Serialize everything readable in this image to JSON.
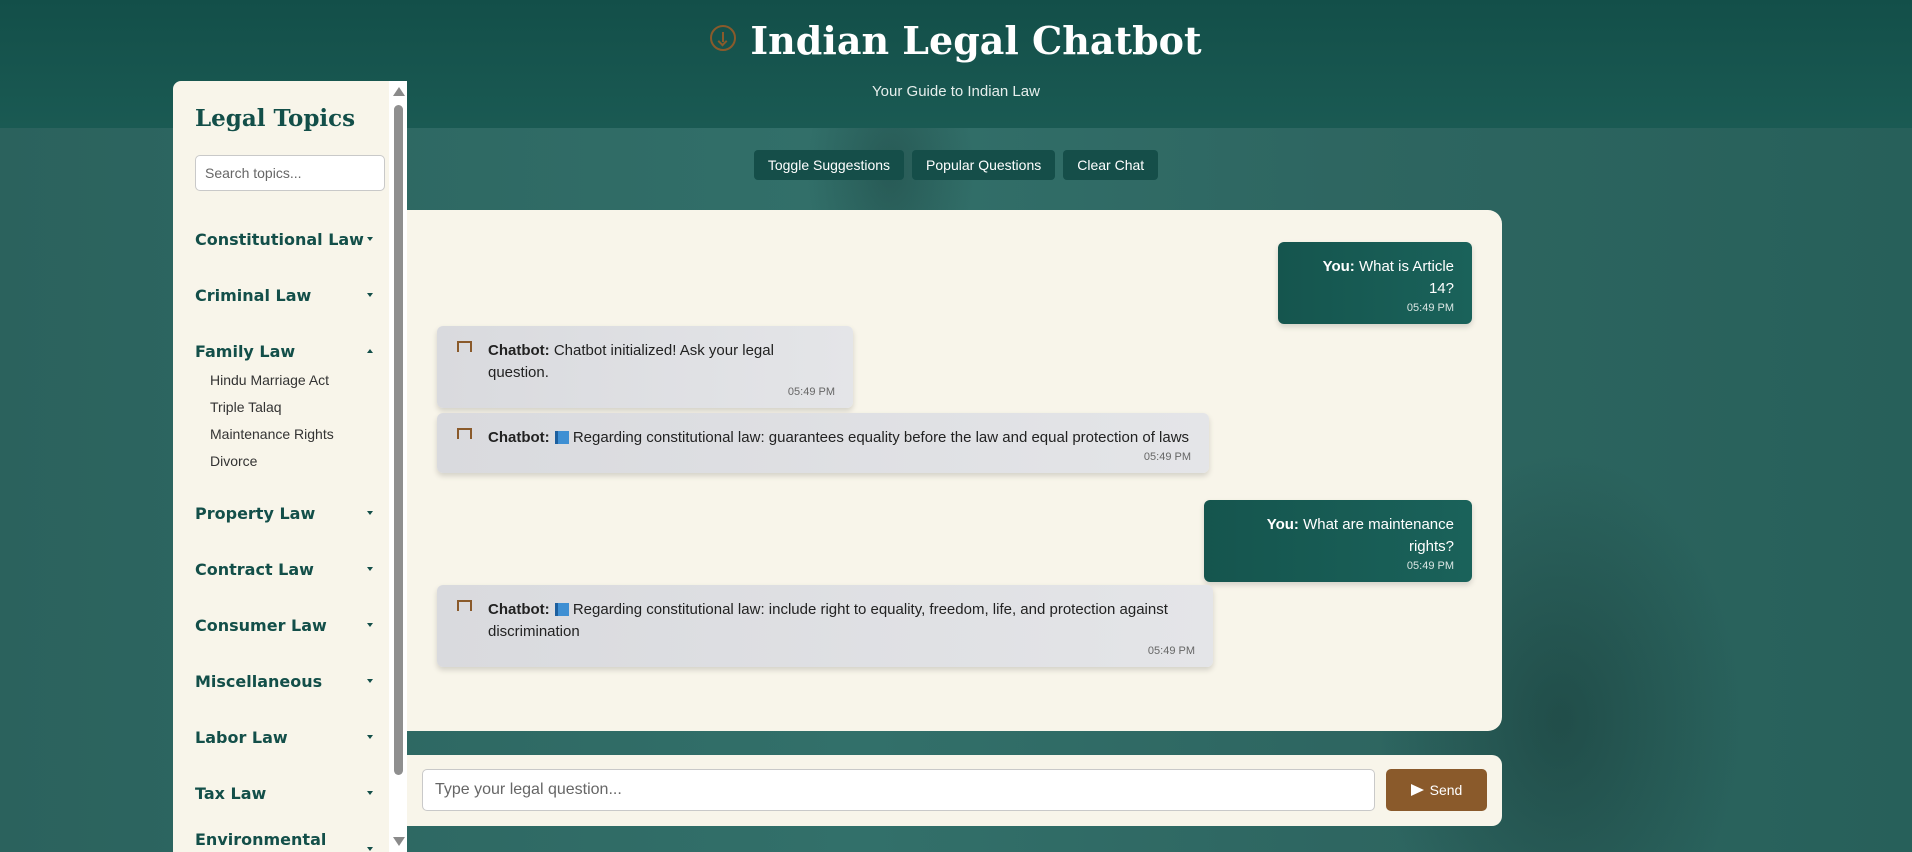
{
  "header": {
    "title": "Indian Legal Chatbot",
    "subtitle": "Your Guide to Indian Law"
  },
  "toolbar": {
    "toggle_suggestions": "Toggle Suggestions",
    "popular_questions": "Popular Questions",
    "clear_chat": "Clear Chat"
  },
  "sidebar": {
    "title": "Legal Topics",
    "search_placeholder": "Search topics...",
    "categories": [
      {
        "label": "Constitutional Law",
        "expanded": false
      },
      {
        "label": "Criminal Law",
        "expanded": false
      },
      {
        "label": "Family Law",
        "expanded": true,
        "items": [
          "Hindu Marriage Act",
          "Triple Talaq",
          "Maintenance Rights",
          "Divorce"
        ]
      },
      {
        "label": "Property Law",
        "expanded": false
      },
      {
        "label": "Contract Law",
        "expanded": false
      },
      {
        "label": "Consumer Law",
        "expanded": false
      },
      {
        "label": "Miscellaneous",
        "expanded": false
      },
      {
        "label": "Labor Law",
        "expanded": false
      },
      {
        "label": "Tax Law",
        "expanded": false
      },
      {
        "label": "Environmental Law",
        "expanded": false
      }
    ]
  },
  "chat": {
    "messages": [
      {
        "sender": "user",
        "speaker": "You:",
        "text": "What is Article 14?",
        "time": "05:49 PM"
      },
      {
        "sender": "bot",
        "speaker": "Chatbot:",
        "text": "Chatbot initialized! Ask your legal question.",
        "time": "05:49 PM"
      },
      {
        "sender": "bot",
        "speaker": "Chatbot:",
        "text": "Regarding constitutional law: guarantees equality before the law and equal protection of laws",
        "time": "05:49 PM",
        "icon": "book-icon"
      },
      {
        "sender": "user",
        "speaker": "You:",
        "text": "What are maintenance rights?",
        "time": "05:49 PM"
      },
      {
        "sender": "bot",
        "speaker": "Chatbot:",
        "text": "Regarding constitutional law: include right to equality, freedom, life, and protection against discrimination",
        "time": "05:49 PM",
        "icon": "book-icon"
      }
    ]
  },
  "input": {
    "placeholder": "Type your legal question...",
    "send_label": "Send"
  },
  "colors": {
    "primary": "#134f49",
    "accent": "#8a5a2b",
    "panel": "#f8f5ea"
  }
}
